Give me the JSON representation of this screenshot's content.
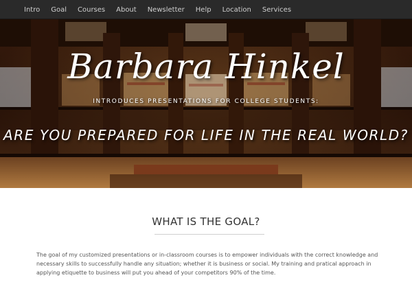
{
  "nav": {
    "items": [
      "Intro",
      "Goal",
      "Courses",
      "About",
      "Newsletter",
      "Help",
      "Location",
      "Services"
    ]
  },
  "hero": {
    "name": "Barbara Hinkel",
    "subtitle": "INTRODUCES PRESENTATIONS FOR COLLEGE STUDENTS:",
    "tagline": "ARE YOU PREPARED FOR LIFE IN THE REAL WORLD?"
  },
  "goal": {
    "title": "WHAT IS THE GOAL?",
    "text": "The goal of my customized presentations or in-classroom courses is to empower individuals with the correct knowledge and necessary skills to successfully handle any situation; whether it is business or social. My training and pratical approach in applying etiquette to business will put you ahead of your competitors 90% of the time."
  },
  "colors": {
    "nav_bg": "#2a2a2a",
    "nav_text": "#cfcfcf",
    "heading": "#333333",
    "body_text": "#555555"
  }
}
